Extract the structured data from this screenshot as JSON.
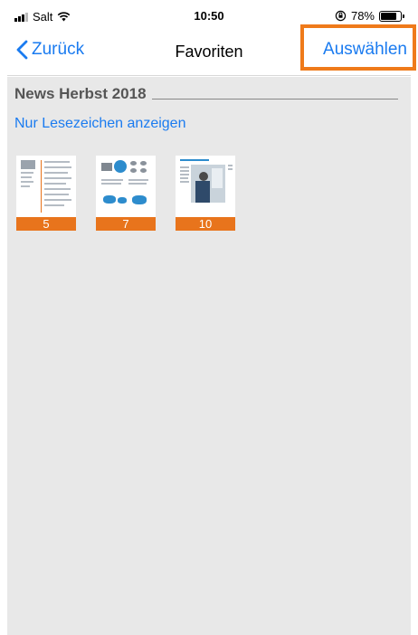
{
  "status_bar": {
    "carrier": "Salt",
    "time": "10:50",
    "battery": "78%"
  },
  "nav": {
    "back_label": "Zurück",
    "title": "Favoriten",
    "select_label": "Auswählen"
  },
  "section": {
    "title": "News Herbst 2018"
  },
  "bookmarks_link": "Nur Lesezeichen anzeigen",
  "thumbnails": [
    {
      "page": "5"
    },
    {
      "page": "7"
    },
    {
      "page": "10"
    }
  ],
  "colors": {
    "accent": "#1a7bf0",
    "page_badge": "#e8741c",
    "highlight": "#ef7a1a",
    "background": "#e8e8e8"
  }
}
